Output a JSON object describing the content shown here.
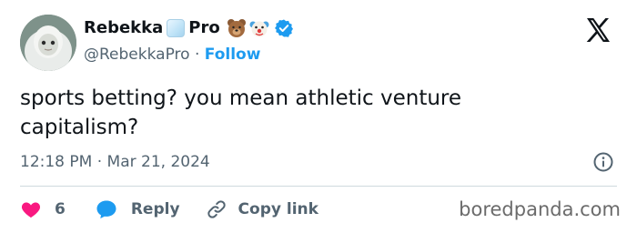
{
  "author": {
    "display_name_prefix": "Rebekka",
    "display_name_suffix": "Pro",
    "name_emoji_icons": [
      "ice-cube-icon",
      "bear-face-icon",
      "clown-face-icon"
    ],
    "verified_icon": "verified-badge-icon",
    "handle": "@RebekkaPro",
    "separator": "·",
    "follow_label": "Follow"
  },
  "platform_icon": "x-logo-icon",
  "tweet": {
    "text": "sports betting? you mean athletic venture capitalism?",
    "time": "12:18 PM",
    "separator": "·",
    "date": "Mar 21, 2024"
  },
  "actions": {
    "likes": "6",
    "reply_label": "Reply",
    "copy_link_label": "Copy link"
  },
  "watermark": "boredpanda.com",
  "colors": {
    "accent": "#1d9bf0",
    "like": "#f91880",
    "text_primary": "#0f1419",
    "text_secondary": "#536471",
    "divider": "#cfd9de"
  }
}
